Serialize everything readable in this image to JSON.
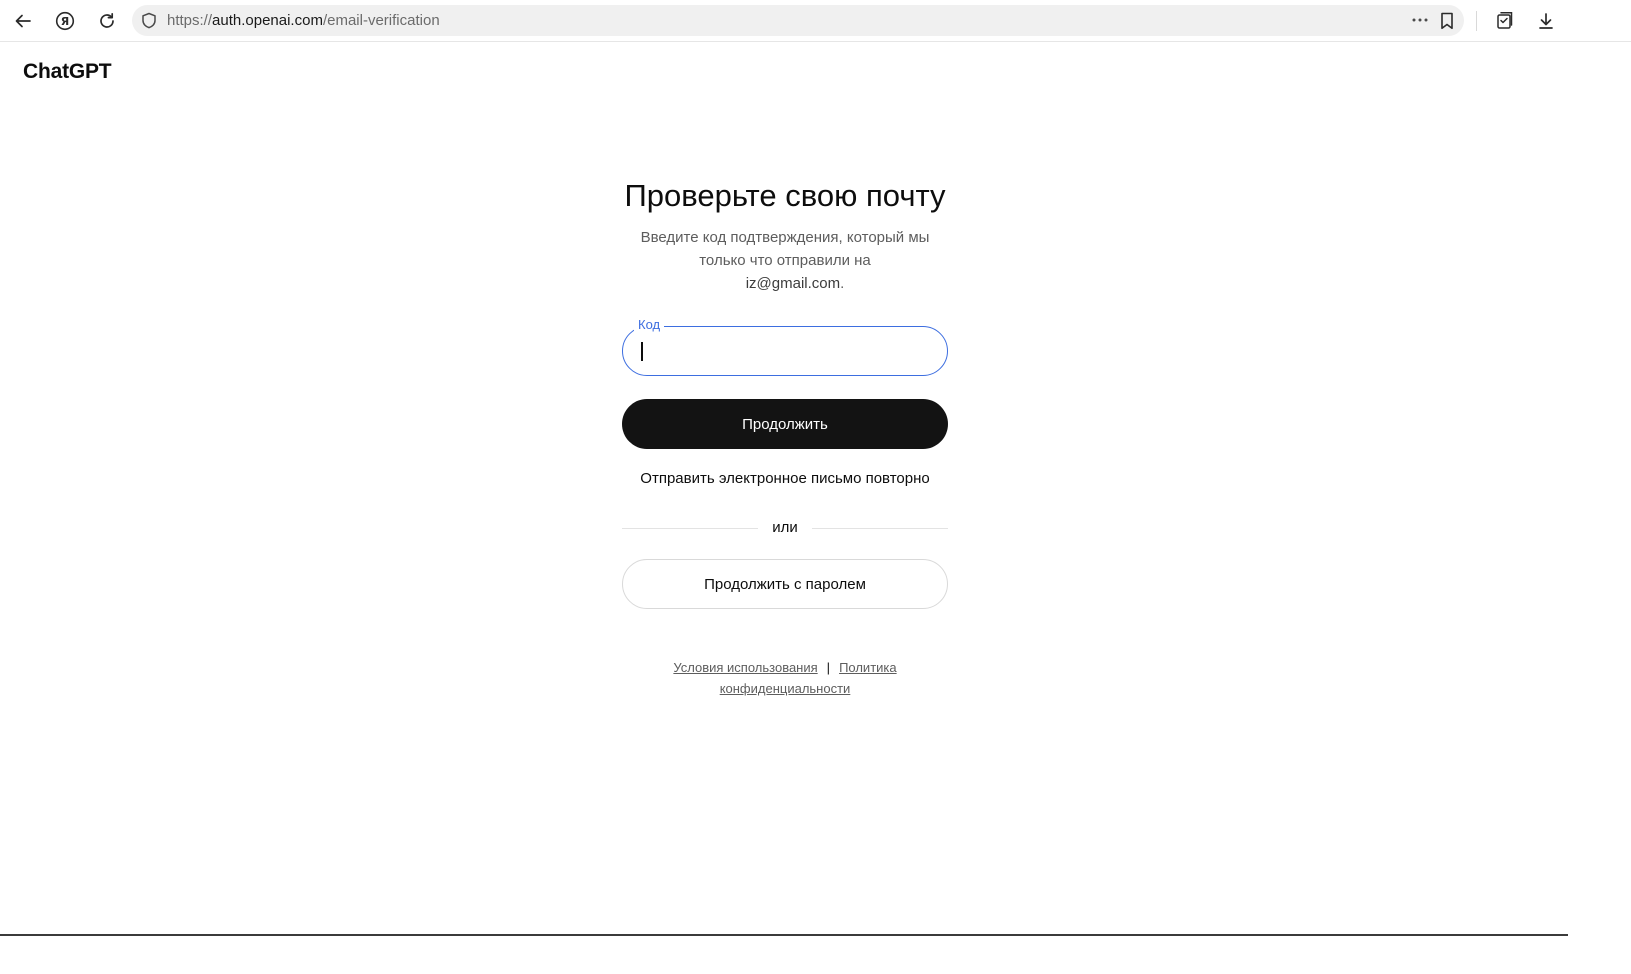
{
  "browser": {
    "url_scheme": "https://",
    "url_host": "auth.openai.com",
    "url_path": "/email-verification",
    "more_glyph": "···"
  },
  "page": {
    "brand": "ChatGPT",
    "title": "Проверьте свою почту",
    "subtitle_line1": "Введите код подтверждения, который мы",
    "subtitle_line2": "только что отправили на",
    "email": "iz@gmail.com",
    "email_suffix": ".",
    "code_label": "Код",
    "code_value": "",
    "continue_label": "Продолжить",
    "resend_label": "Отправить электронное письмо повторно",
    "or_label": "или",
    "password_label": "Продолжить с паролем",
    "terms_label": "Условия использования",
    "separator": "|",
    "privacy_label_1": "Политика",
    "privacy_label_2": "конфиденциальности"
  },
  "colors": {
    "accent": "#3d6ee0",
    "primary_button": "#131313",
    "muted_text": "#5d5d5d"
  },
  "icons": [
    "back-arrow-icon",
    "yandex-icon",
    "reload-icon",
    "shield-icon",
    "more-icon",
    "bookmark-icon",
    "collections-icon",
    "download-icon"
  ]
}
